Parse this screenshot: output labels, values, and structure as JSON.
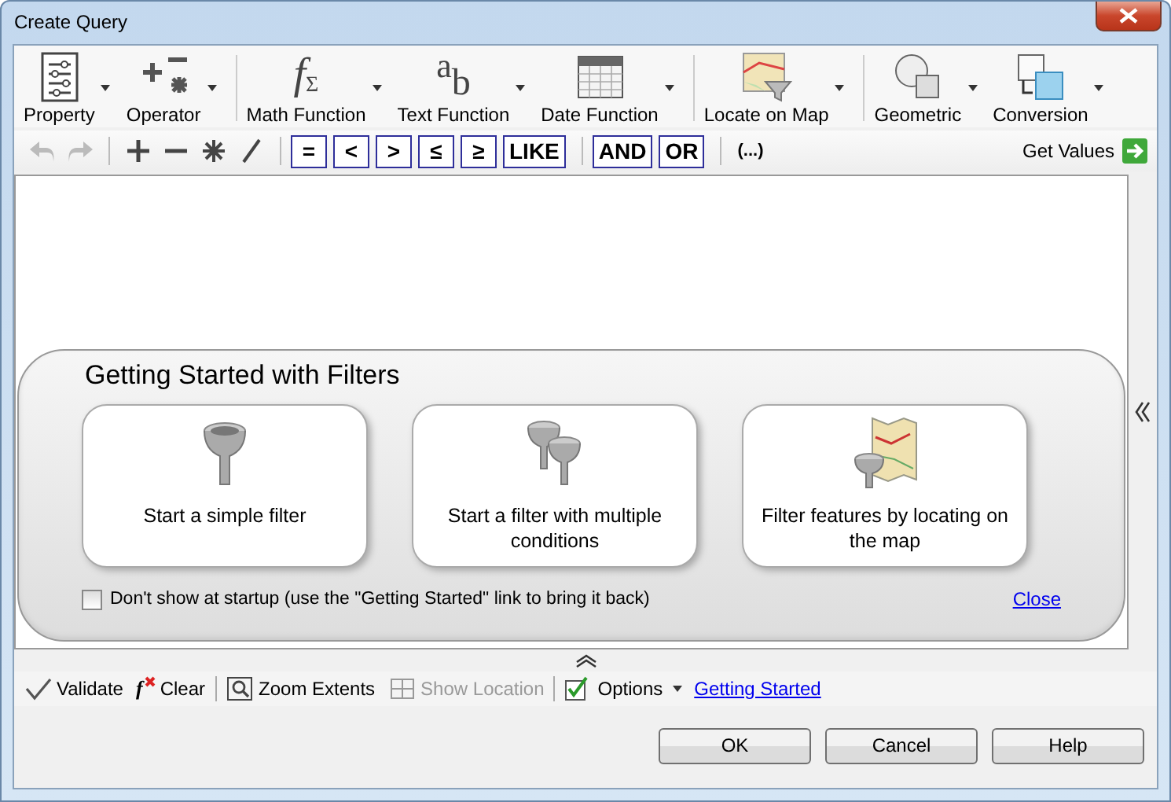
{
  "window": {
    "title": "Create Query"
  },
  "ribbon_groups": [
    {
      "buttons": [
        {
          "label": "Property",
          "kind": "property"
        },
        {
          "label": "Operator",
          "kind": "operator"
        }
      ]
    },
    {
      "buttons": [
        {
          "label": "Math Function",
          "kind": "math",
          "icon_text": [
            "f",
            "Σ"
          ]
        },
        {
          "label": "Text Function",
          "kind": "text",
          "icon_text": [
            "a",
            "b"
          ]
        },
        {
          "label": "Date Function",
          "kind": "date"
        }
      ]
    },
    {
      "buttons": [
        {
          "label": "Locate on Map",
          "kind": "map"
        }
      ]
    },
    {
      "buttons": [
        {
          "label": "Geometric",
          "kind": "geometric"
        },
        {
          "label": "Conversion",
          "kind": "conversion"
        }
      ]
    }
  ],
  "tool_groups": [
    {
      "tools": [
        {
          "kind": "undo",
          "disabled": true
        },
        {
          "kind": "redo",
          "disabled": true
        }
      ]
    },
    {
      "tools": [
        {
          "kind": "plus",
          "disabled": false
        },
        {
          "kind": "minus",
          "disabled": false
        },
        {
          "kind": "asterisk",
          "disabled": false
        },
        {
          "kind": "slash",
          "disabled": false
        }
      ]
    }
  ],
  "operator_groups": [
    {
      "operators": [
        "=",
        "<",
        ">",
        "≤",
        "≥",
        "LIKE"
      ]
    },
    {
      "operators": [
        "AND",
        "OR"
      ]
    }
  ],
  "parentheses": "(...)",
  "get_values": "Get Values",
  "getting_started": {
    "title": "Getting Started with Filters",
    "cards": [
      {
        "label": "Start a simple filter",
        "kind": "simple"
      },
      {
        "label": "Start a filter with multiple conditions",
        "kind": "multiple"
      },
      {
        "label": "Filter features by locating on the map",
        "kind": "map"
      }
    ],
    "dont_show": {
      "label": "Don't show at startup (use the \"Getting Started\" link to bring it back)",
      "checked": false
    },
    "close": "Close"
  },
  "bottom_groups": [
    {
      "items": [
        {
          "label": "Validate",
          "kind": "validate",
          "disabled": false
        },
        {
          "label": "Clear",
          "kind": "clear",
          "disabled": false,
          "icon_text": "f"
        }
      ]
    },
    {
      "items": [
        {
          "label": "Zoom Extents",
          "kind": "zoom",
          "disabled": false
        },
        {
          "label": "Show Location",
          "kind": "location",
          "disabled": true
        }
      ]
    },
    {
      "items": [
        {
          "label": "Options",
          "kind": "options",
          "disabled": false
        },
        {
          "label": "Getting Started",
          "kind": "link"
        }
      ]
    }
  ],
  "buttons": [
    "OK",
    "Cancel",
    "Help"
  ]
}
